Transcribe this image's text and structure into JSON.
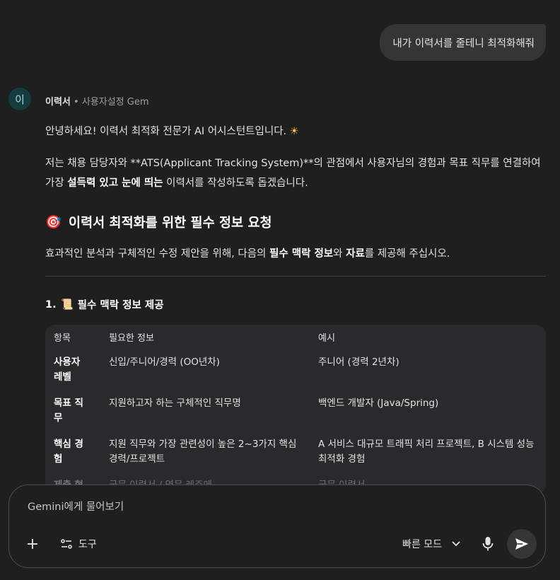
{
  "user_message": "내가 이력서를 줄테니 최적화해줘",
  "gem": {
    "avatar_letter": "이",
    "name": "이력서",
    "separator": " • ",
    "subtitle": "사용자설정 Gem"
  },
  "response": {
    "greeting": "안녕하세요! 이력서 최적화 전문가 AI 어시스턴트입니다.",
    "greeting_emoji": "☀",
    "intro_part1": "저는 채용 담당자와 **ATS(Applicant Tracking System)**의 관점에서 사용자님의 경험과 목표 직무를 연결하여 가장 ",
    "intro_bold": "설득력 있고 눈에 띄는",
    "intro_part2": " 이력서를 작성하도록 돕겠습니다.",
    "section_emoji": "🎯",
    "section_title": "이력서 최적화를 위한 필수 정보 요청",
    "request_part1": "효과적인 분석과 구체적인 수정 제안을 위해, 다음의 ",
    "request_bold1": "필수 맥락 정보",
    "request_part2": "와 ",
    "request_bold2": "자료",
    "request_part3": "를 제공해 주십시오.",
    "subsection_number": "1.",
    "subsection_emoji": "📜",
    "subsection_title": "필수 맥락 정보 제공"
  },
  "table": {
    "headers": [
      "항목",
      "필요한 정보",
      "예시"
    ],
    "rows": [
      [
        "사용자 레벨",
        "신입/주니어/경력 (OO년차)",
        "주니어 (경력 2년차)"
      ],
      [
        "목표 직무",
        "지원하고자 하는 구체적인 직무명",
        "백엔드 개발자 (Java/Spring)"
      ],
      [
        "핵심 경험",
        "지원 직무와 가장 관련성이 높은 2~3가지 핵심 경력/프로젝트",
        "A 서비스 대규모 트래픽 처리 프로젝트, B 시스템 성능 최적화 경험"
      ],
      [
        "제출 형",
        "국문 이력서 / 영문 레주메",
        "국문 이력서"
      ]
    ]
  },
  "composer": {
    "placeholder": "Gemini에게 물어보기",
    "tools_label": "도구",
    "mode_label": "빠른 모드"
  },
  "colors": {
    "background": "#1f1f1f",
    "bubble": "#333537",
    "table_bg": "#292a2d",
    "avatar_bg": "#163c40"
  }
}
